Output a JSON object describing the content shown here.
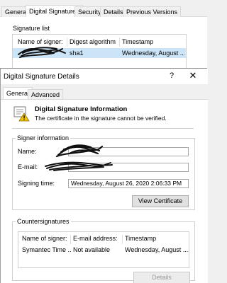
{
  "background_window": {
    "tabs": [
      {
        "label": "General"
      },
      {
        "label": "Digital Signatures"
      },
      {
        "label": "Security"
      },
      {
        "label": "Details"
      },
      {
        "label": "Previous Versions"
      }
    ],
    "signature_list_label": "Signature list",
    "columns": {
      "name": "Name of signer:",
      "digest": "Digest algorithm",
      "timestamp": "Timestamp"
    },
    "row": {
      "digest": "sha1",
      "timestamp": "Wednesday, August ..."
    }
  },
  "dialog": {
    "title": "Digital Signature Details",
    "help_glyph": "?",
    "close_glyph": "✕",
    "tabs": [
      {
        "label": "General"
      },
      {
        "label": "Advanced"
      }
    ],
    "info_heading": "Digital Signature Information",
    "info_message": "The certificate in the signature cannot be verified.",
    "signer_group_label": "Signer information",
    "name_label": "Name:",
    "email_label": "E-mail:",
    "signing_time_label": "Signing time:",
    "signing_time_value": "Wednesday, August 26, 2020 2:06:33 PM",
    "view_certificate_button": "View Certificate",
    "countersignatures_group_label": "Countersignatures",
    "countersignatures": {
      "columns": {
        "name": "Name of signer:",
        "email": "E-mail address:",
        "timestamp": "Timestamp"
      },
      "rows": [
        {
          "name": "Symantec Time ...",
          "email": "Not available",
          "timestamp": "Wednesday, August ..."
        }
      ]
    },
    "details_button": "Details"
  },
  "icons": {
    "certificate": "certificate-warning-icon"
  },
  "colors": {
    "selection": "#cce4f7",
    "scribble": "#111111",
    "warning": "#f5c400"
  }
}
